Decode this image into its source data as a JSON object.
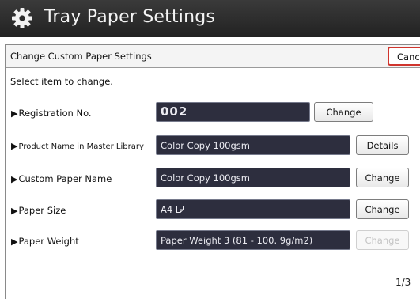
{
  "header": {
    "title": "Tray Paper Settings",
    "icon": "gear-icon"
  },
  "subheader": {
    "label": "Change Custom Paper Settings",
    "cancel_label": "Canc"
  },
  "instruction": "Select item to change.",
  "rows": [
    {
      "label": "Registration No.",
      "value": "002",
      "button": "Change",
      "button_enabled": true
    },
    {
      "label": "Product Name in Master Library",
      "value": "Color Copy 100gsm",
      "button": "Details",
      "button_enabled": true
    },
    {
      "label": "Custom Paper Name",
      "value": "Color Copy 100gsm",
      "button": "Change",
      "button_enabled": true
    },
    {
      "label": "Paper Size",
      "value": "A4",
      "value_icon": "landscape-orientation-icon",
      "button": "Change",
      "button_enabled": true
    },
    {
      "label": "Paper Weight",
      "value": "Paper Weight 3 (81 - 100. 9g/m2)",
      "button": "Change",
      "button_enabled": false
    }
  ],
  "pagination": {
    "text": "1/3"
  },
  "colors": {
    "title_bar": "#2b2b2b",
    "field_bg": "#2d2e3e",
    "cancel_border": "#d0352d"
  }
}
